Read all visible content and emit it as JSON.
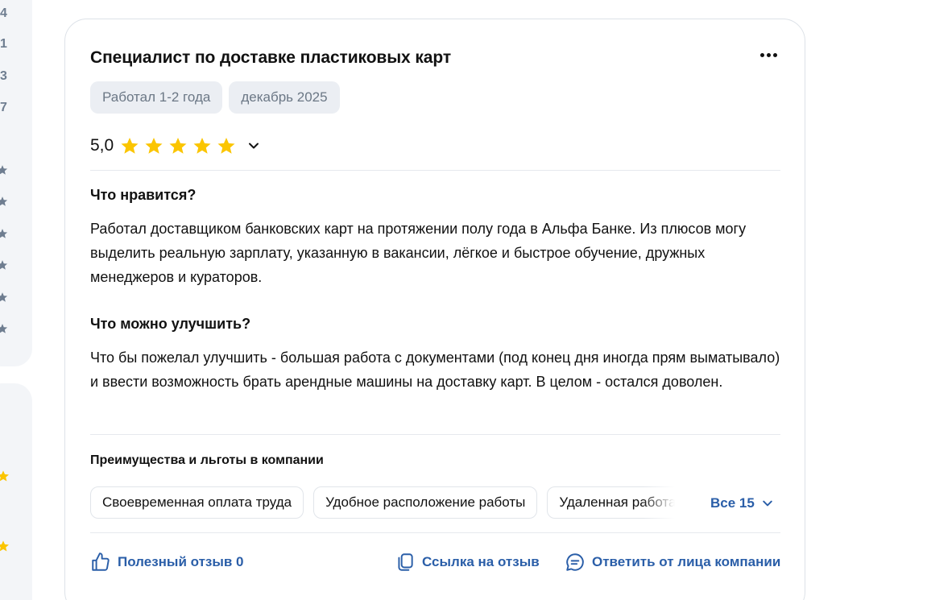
{
  "sidebar": {
    "numbers": [
      "4",
      "1",
      "3",
      "7"
    ]
  },
  "review": {
    "title": "Специалист по доставке пластиковых карт",
    "tags": [
      "Работал 1-2 года",
      "декабрь 2025"
    ],
    "rating": {
      "value": "5,0",
      "stars_filled": 5,
      "stars_total": 5
    },
    "likes": {
      "heading": "Что нравится?",
      "text": "Работал доставщиком банковских карт на протяжении полу года в Альфа Банке. Из плюсов могу выделить реальную зарплату, указанную в вакансии, лёгкое и быстрое обучение, дружных менеджеров и кураторов."
    },
    "improve": {
      "heading": "Что можно улучшить?",
      "text": "Что бы пожелал улучшить - большая работа с документами (под конец дня иногда прям выматывало) и ввести возможность брать арендные машины на доставку карт. В целом - остался доволен."
    },
    "benefits": {
      "title": "Преимущества и льготы в компании",
      "chips": [
        "Своевременная оплата труда",
        "Удобное расположение работы",
        "Удаленная работа"
      ],
      "all_label": "Все 15"
    },
    "actions": {
      "helpful": "Полезный отзыв 0",
      "link": "Ссылка на отзыв",
      "reply": "Ответить от лица компании"
    }
  },
  "colors": {
    "star": "#fbc500",
    "accent": "#2a5ea8",
    "tag_bg": "#ebeef3",
    "sidebar_bg": "#f3f5f8"
  }
}
